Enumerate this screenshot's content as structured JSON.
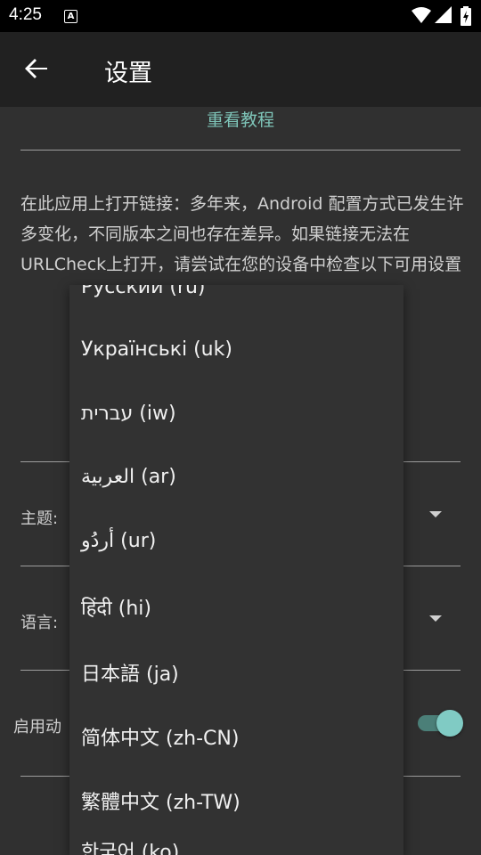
{
  "status": {
    "time": "4:25",
    "a_icon": "A"
  },
  "appbar": {
    "title": "设置"
  },
  "settings": {
    "tutorial_label": "重看教程",
    "description": "在此应用上打开链接：多年来，Android 配置方式已发生许多变化，不同版本之间也存在差异。如果链接无法在URLCheck上打开，请尝试在您的设备中检查以下可用设置",
    "theme_label": "主题:",
    "language_label": "语言:",
    "startup_label": "启用动"
  },
  "dropdown": {
    "items": [
      "Русский (ru)",
      "Українські (uk)",
      "עברית (iw)",
      "العربية (ar)",
      "أردُو (ur)",
      "हिंदी (hi)",
      "日本語 (ja)",
      "简体中文 (zh-CN)",
      "繁體中文 (zh-TW)",
      "한국어 (ko)"
    ]
  },
  "colors": {
    "accent": "#80cbc4",
    "background": "#303030",
    "appbar": "#212121"
  }
}
